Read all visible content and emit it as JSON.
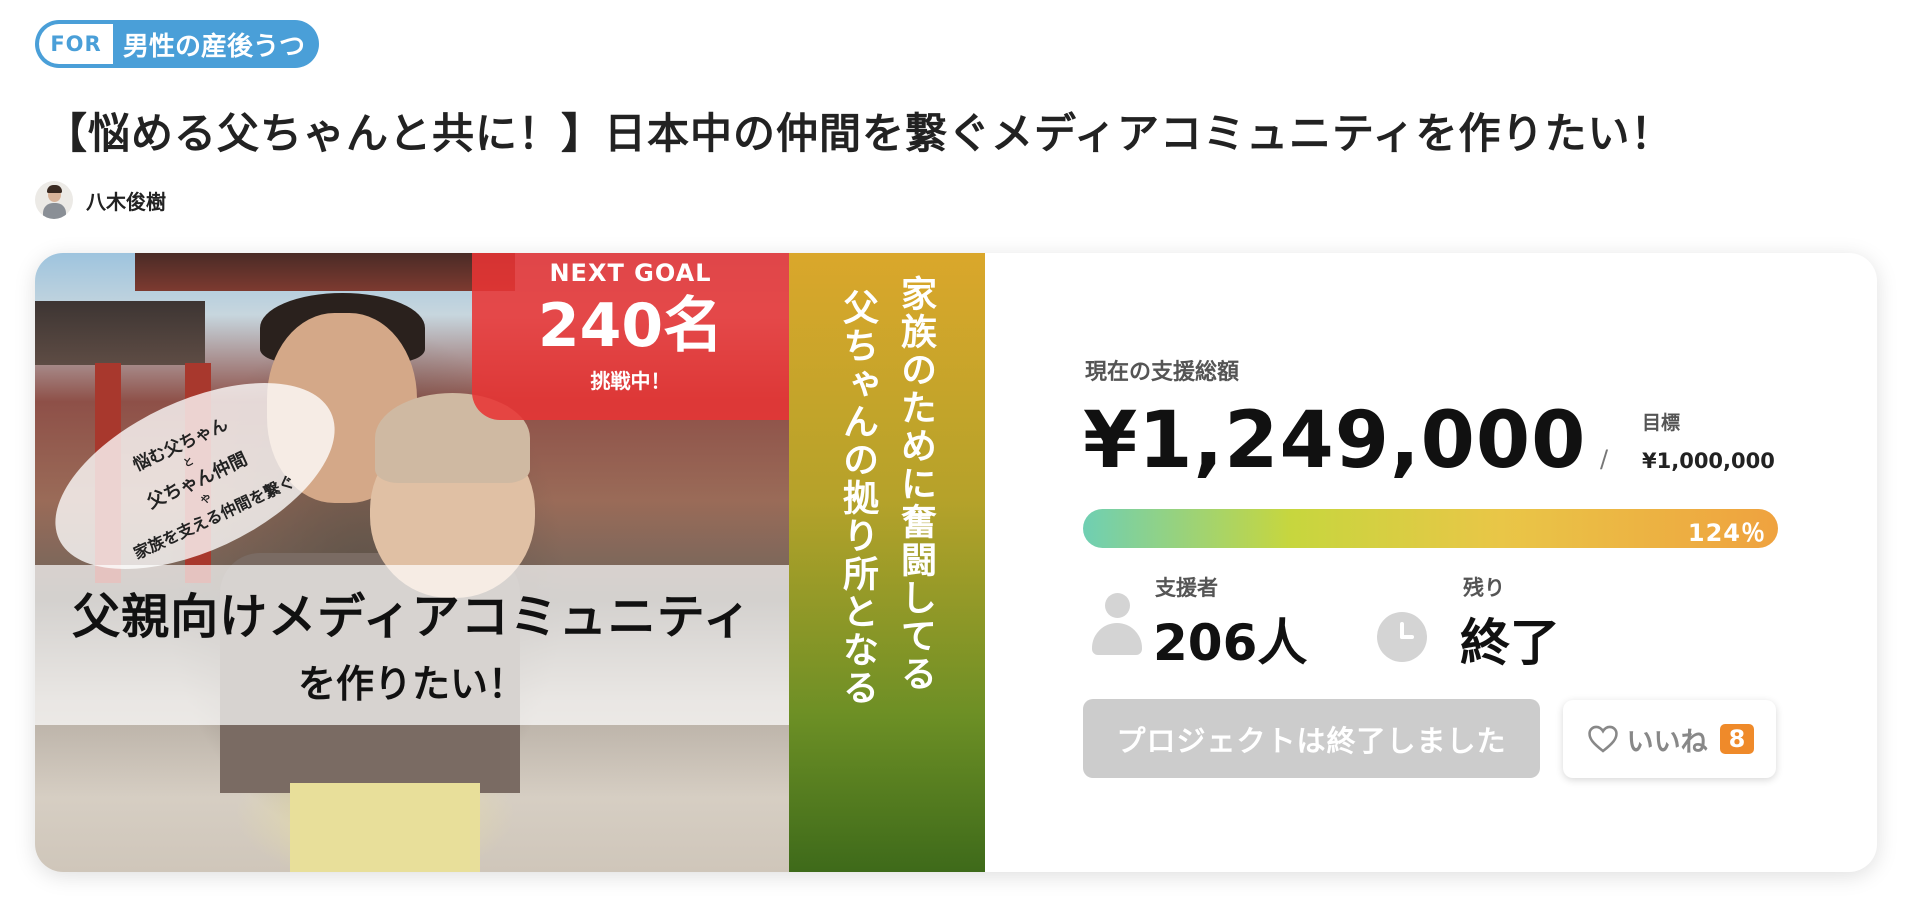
{
  "tag": {
    "for": "FOR",
    "label": "男性の産後うつ"
  },
  "project": {
    "title": "【悩める父ちゃんと共に！】日本中の仲間を繋ぐメディアコミュニティを作りたい！",
    "author": "八木俊樹"
  },
  "hero": {
    "next_goal_label": "NEXT GOAL",
    "next_goal_value": "240名",
    "next_goal_status": "挑戦中！",
    "bubble": {
      "line1": "悩む父ちゃん",
      "line2": "と",
      "line3": "父ちゃん仲間",
      "line4": "や",
      "line5": "家族を支える仲間を繋ぐ"
    },
    "headline1": "父親向けメディアコミュニティ",
    "headline2": "を作りたい！",
    "vertical_col1": "家族のために奮闘してる",
    "vertical_col2": "父ちゃんの拠り所となる"
  },
  "stats": {
    "total_label": "現在の支援総額",
    "total_amount": "¥1,249,000",
    "slash": "/",
    "goal_label": "目標",
    "goal_amount": "¥1,000,000",
    "progress_text": "124％",
    "progress_fraction": 1.24,
    "supporters_label": "支援者",
    "supporters_value": "206人",
    "remaining_label": "残り",
    "remaining_value": "終了"
  },
  "actions": {
    "ended_label": "プロジェクトは終了しました",
    "like_label": "いいね",
    "like_count": "8"
  },
  "colors": {
    "tag_blue": "#4a9fd8",
    "goal_red": "#e83434",
    "like_badge": "#ef8a2a",
    "disabled_button": "#cccccc"
  },
  "icons": [
    "avatar",
    "person-icon",
    "clock-icon",
    "heart-icon"
  ]
}
